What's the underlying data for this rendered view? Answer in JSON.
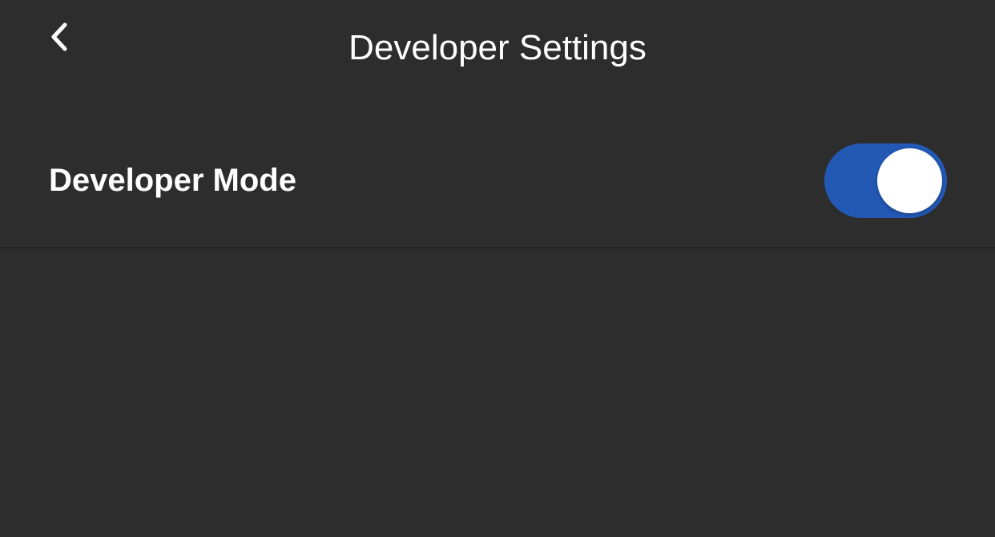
{
  "nav": {
    "back_icon": "chevron-left-icon",
    "title": "Developer Settings"
  },
  "settings": [
    {
      "label": "Developer Mode",
      "toggle_on": true
    }
  ],
  "colors": {
    "background": "#2d2d2d",
    "toggle_active": "#2358b5",
    "text": "#ffffff",
    "divider": "#262626"
  }
}
